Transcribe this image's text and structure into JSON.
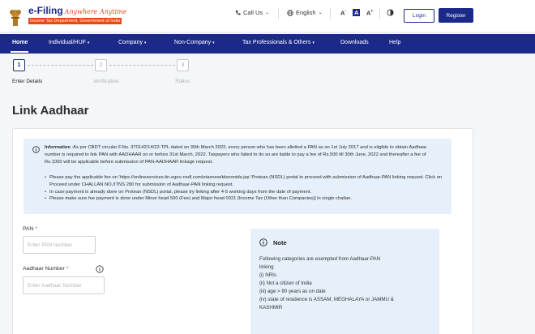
{
  "header": {
    "logo_title": "e-Filing",
    "logo_tagline": "Anywhere Anytime",
    "logo_subtitle": "Income Tax Department, Government of India",
    "call_us": "Call Us",
    "language": "English",
    "font_small": "A",
    "font_normal": "A",
    "font_large": "A",
    "font_large_sup": "+",
    "font_small_sup": "-",
    "login": "Login",
    "register": "Register"
  },
  "nav": {
    "items": [
      {
        "label": "Home",
        "chevron": ""
      },
      {
        "label": "Individual/HUF",
        "chevron": "▾"
      },
      {
        "label": "Company",
        "chevron": "▾"
      },
      {
        "label": "Non-Company",
        "chevron": "▾"
      },
      {
        "label": "Tax Professionals & Others",
        "chevron": "▾"
      },
      {
        "label": "Downloads",
        "chevron": ""
      },
      {
        "label": "Help",
        "chevron": ""
      }
    ]
  },
  "stepper": {
    "steps": [
      {
        "number": "1",
        "label": "Enter Details",
        "state": "active"
      },
      {
        "number": "2",
        "label": "Verification",
        "state": "inactive"
      },
      {
        "number": "3",
        "label": "Status",
        "state": "inactive"
      }
    ]
  },
  "page": {
    "title": "Link Aadhaar"
  },
  "info": {
    "heading": "Information",
    "text": ":As per CBDT circular F.No. 370142/14/22-TPL dated on 30th March 2022, every person who has been allotted a PAN as on 1st July 2017 and is eligible to obtain Aadhaar number is required to link PAN with AADHAAR on or before 31st March, 2022. Taxpayers who failed to do so are liable to pay a fee of Rs.500 till 30th June, 2022 and thereafter a fee of Rs.1000 will be applicable before submission of PAN-AADHAAR linkage request.",
    "bullets": [
      "Please pay the applicable fee on 'https://onlineservices.tin.egov-nsdl.com/etaxnew/tdsnontds.jsp' Protean (NSDL) portal to proceed with submission of Aadhaar-PAN linking request. Click on Proceed under CHALLAN NO./ITNS 280 for submission of Aadhaar-PAN linking request.",
      "In case payment is already done on Protean (NSDL) portal, please try linking after 4-5 working days from the date of payment.",
      "Please make sure fee payment is done under Minor head 500 (Fee) and Major head 0021 [Income Tax (Other than Companies)] in single challan."
    ]
  },
  "form": {
    "pan_label": "PAN",
    "pan_required": "*",
    "pan_placeholder": "Enter PAN Number",
    "aadhaar_label": "Aadhaar Number",
    "aadhaar_required": "*",
    "aadhaar_placeholder": "Enter Aadhaar Number"
  },
  "note": {
    "title": "Note",
    "lines": [
      "Following categories are exempted from Aadhaar-PAN",
      "linking",
      "(i) NRIs",
      "(ii) Not a citizen of India",
      "(iii) age > 80 years as on date",
      "(iv) state of residence is ASSAM, MEGHALAYA or JAMMU &",
      "KASHMIR"
    ]
  },
  "colors": {
    "brand": "#1b2a8a",
    "accent": "#e8471c",
    "info_bg": "#e6f0fa",
    "required": "#e53935"
  },
  "icons": {
    "phone": "phone-icon",
    "globe": "globe-icon",
    "contrast": "contrast-icon",
    "info": "info-icon",
    "help": "help-icon"
  }
}
